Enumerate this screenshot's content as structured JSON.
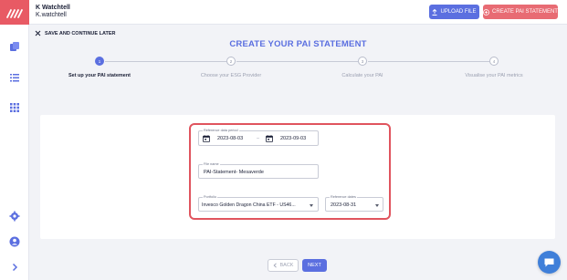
{
  "header": {
    "user_name": "K Watchtell",
    "user_handle": "K.watchtell",
    "upload_label": "UPLOAD FILE",
    "create_label": "CREATE PAI STATEMENT"
  },
  "save_label": "SAVE AND CONTINUE LATER",
  "page_title": "CREATE YOUR PAI STATEMENT",
  "steps": [
    {
      "number": "1",
      "label": "Set up your PAI statement",
      "active": true
    },
    {
      "number": "2",
      "label": "Choose your ESG Provider",
      "active": false
    },
    {
      "number": "3",
      "label": "Calculate your PAI",
      "active": false
    },
    {
      "number": "4",
      "label": "Visualise your PAI metrics",
      "active": false
    }
  ],
  "form": {
    "reference_period_label": "Reference data period",
    "start_date": "2023-08-03",
    "date_separator": "–",
    "end_date": "2023-09-03",
    "file_name_label": "File name",
    "file_name_value": "PAI-Statement-  Mesaverde",
    "portfolio_label": "Portfolio",
    "portfolio_value": "Invesco Golden Dragon China ETF - US46...",
    "reference_dates_label": "Reference dates",
    "reference_dates_value": "2023-08-31"
  },
  "nav": {
    "back_label": "BACK",
    "next_label": "NEXT"
  },
  "colors": {
    "accent": "#5b6fe0",
    "brand_red": "#e85a64",
    "highlight": "#e0545e"
  }
}
